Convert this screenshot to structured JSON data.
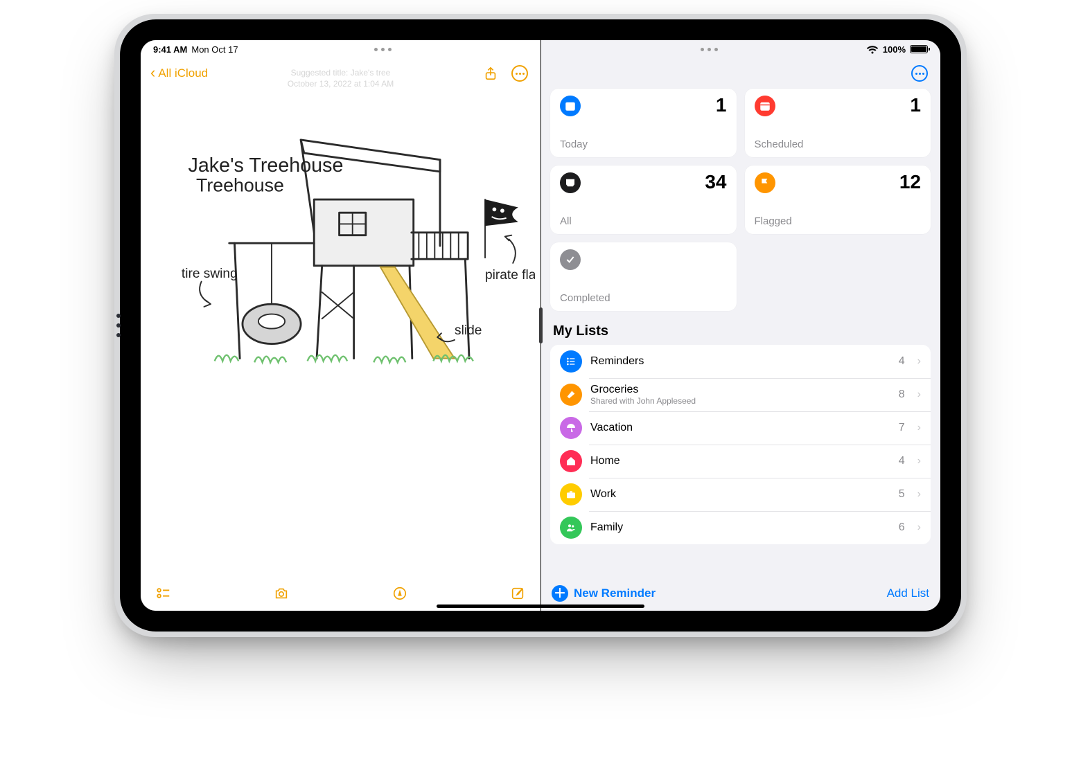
{
  "status": {
    "time": "9:41 AM",
    "date": "Mon Oct 17",
    "battery_pct": "100%"
  },
  "notes": {
    "back_label": "All iCloud",
    "suggested_title": "Suggested title: Jake's tree",
    "timestamp_line": "October 13, 2022 at 1:04 AM",
    "annotations": {
      "title": "Jake's Treehouse",
      "tire_swing": "tire swing",
      "pirate_flag": "pirate flag",
      "slide": "slide"
    }
  },
  "reminders": {
    "cards": {
      "today": {
        "label": "Today",
        "count": "1"
      },
      "scheduled": {
        "label": "Scheduled",
        "count": "1"
      },
      "all": {
        "label": "All",
        "count": "34"
      },
      "flagged": {
        "label": "Flagged",
        "count": "12"
      },
      "completed": {
        "label": "Completed"
      }
    },
    "section_title": "My Lists",
    "lists": [
      {
        "name": "Reminders",
        "count": "4",
        "color": "#007aff",
        "icon": "list"
      },
      {
        "name": "Groceries",
        "sub": "Shared with John Appleseed",
        "count": "8",
        "color": "#ff9500",
        "icon": "carrot"
      },
      {
        "name": "Vacation",
        "count": "7",
        "color": "#c969e6",
        "icon": "umbrella"
      },
      {
        "name": "Home",
        "count": "4",
        "color": "#ff2d55",
        "icon": "home"
      },
      {
        "name": "Work",
        "count": "5",
        "color": "#ffcc00",
        "icon": "briefcase"
      },
      {
        "name": "Family",
        "count": "6",
        "color": "#34c759",
        "icon": "people"
      }
    ],
    "footer": {
      "new_reminder": "New Reminder",
      "add_list": "Add List"
    }
  },
  "colors": {
    "today": "#007aff",
    "scheduled": "#ff3b30",
    "all": "#1c1c1e",
    "flagged": "#ff9500",
    "completed": "#8e8e93"
  }
}
